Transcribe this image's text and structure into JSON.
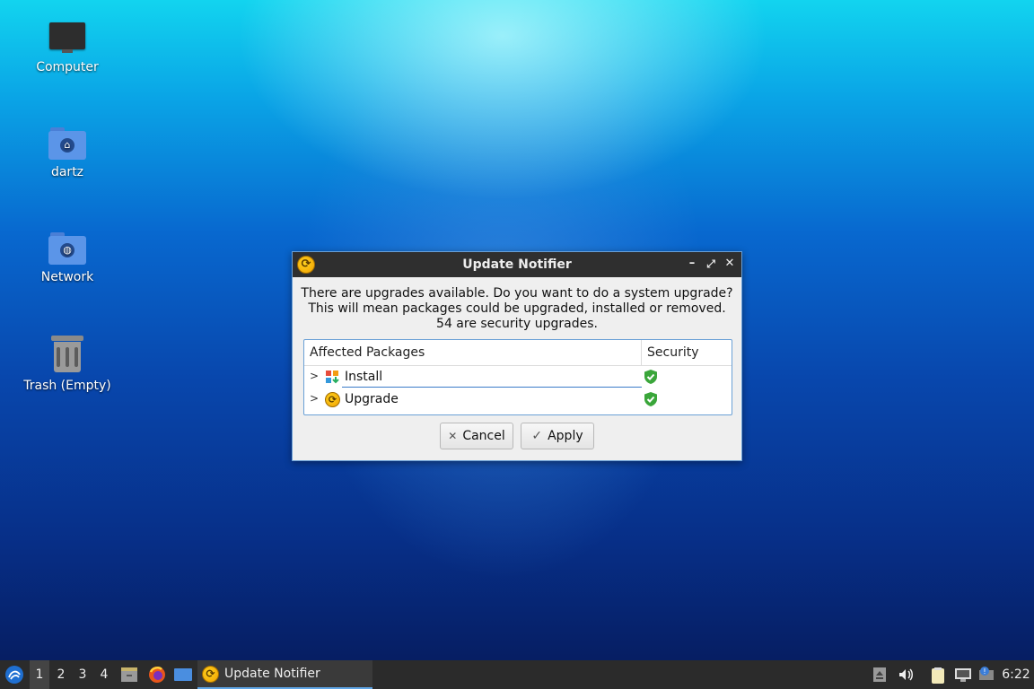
{
  "desktop": {
    "icons": [
      {
        "label": "Computer"
      },
      {
        "label": "dartz"
      },
      {
        "label": "Network"
      },
      {
        "label": "Trash (Empty)"
      }
    ]
  },
  "dialog": {
    "title": "Update Notifier",
    "message_lines": [
      "There are upgrades available. Do you want to do a system upgrade?",
      "This will mean packages could be upgraded, installed or removed.",
      "54 are security upgrades."
    ],
    "table": {
      "columns": [
        "Affected Packages",
        "Security"
      ],
      "rows": [
        {
          "label": "Install",
          "security": "shield-check-icon"
        },
        {
          "label": "Upgrade",
          "security": "shield-check-icon"
        }
      ]
    },
    "buttons": {
      "cancel": "Cancel",
      "apply": "Apply"
    }
  },
  "taskbar": {
    "workspaces": [
      "1",
      "2",
      "3",
      "4"
    ],
    "active_workspace": "1",
    "task_label": "Update Notifier",
    "clock": "6:22"
  },
  "colors": {
    "accent": "#5fa5e6",
    "titlebar": "#2f2f2f",
    "taskbar": "#2b2b2b",
    "shield": "#3aa63a"
  }
}
